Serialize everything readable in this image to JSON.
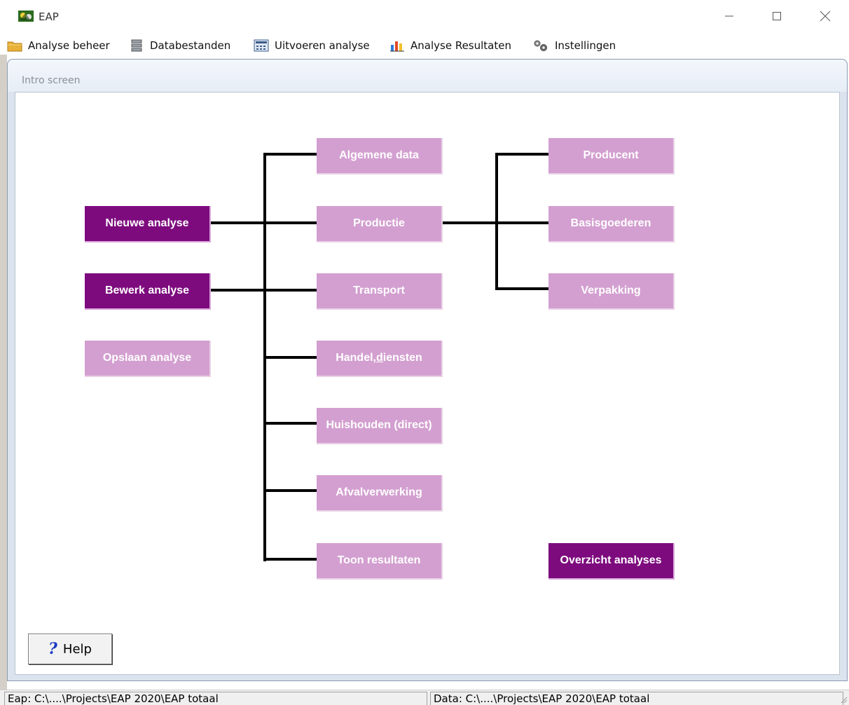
{
  "window": {
    "title": "EAP"
  },
  "menu": [
    {
      "label": "Analyse beheer",
      "icon": "folder-icon"
    },
    {
      "label": "Databestanden",
      "icon": "database-icon"
    },
    {
      "label": "Uitvoeren analyse",
      "icon": "calculator-icon"
    },
    {
      "label": "Analyse Resultaten",
      "icon": "bar-chart-icon"
    },
    {
      "label": "Instellingen",
      "icon": "gears-icon"
    }
  ],
  "screen": {
    "title": "Intro screen"
  },
  "actions": {
    "nieuwe": "Nieuwe analyse",
    "bewerk": "Bewerk analyse",
    "opslaan": "Opslaan analyse",
    "overzicht": "Overzicht analyses"
  },
  "steps": {
    "algemene": "Algemene data",
    "productie": "Productie",
    "transport": "Transport",
    "handel_pre": "Handel, ",
    "handel_key": "d",
    "handel_post": "iensten",
    "huishouden": "Huishouden (direct)",
    "afval": "Afvalverwerking",
    "toon": "Toon resultaten"
  },
  "production_steps": {
    "producent": "Producent",
    "basis": "Basisgoederen",
    "verpakking": "Verpakking"
  },
  "help": {
    "label": "Help",
    "icon": "question-mark-icon"
  },
  "status": {
    "eap": "Eap: C:\\....\\Projects\\EAP 2020\\EAP totaal",
    "data": "Data: C:\\....\\Projects\\EAP 2020\\EAP totaal"
  },
  "colors": {
    "dark_purple": "#7d0b7e",
    "light_purple": "#d39fd0",
    "connector": "#000000"
  }
}
